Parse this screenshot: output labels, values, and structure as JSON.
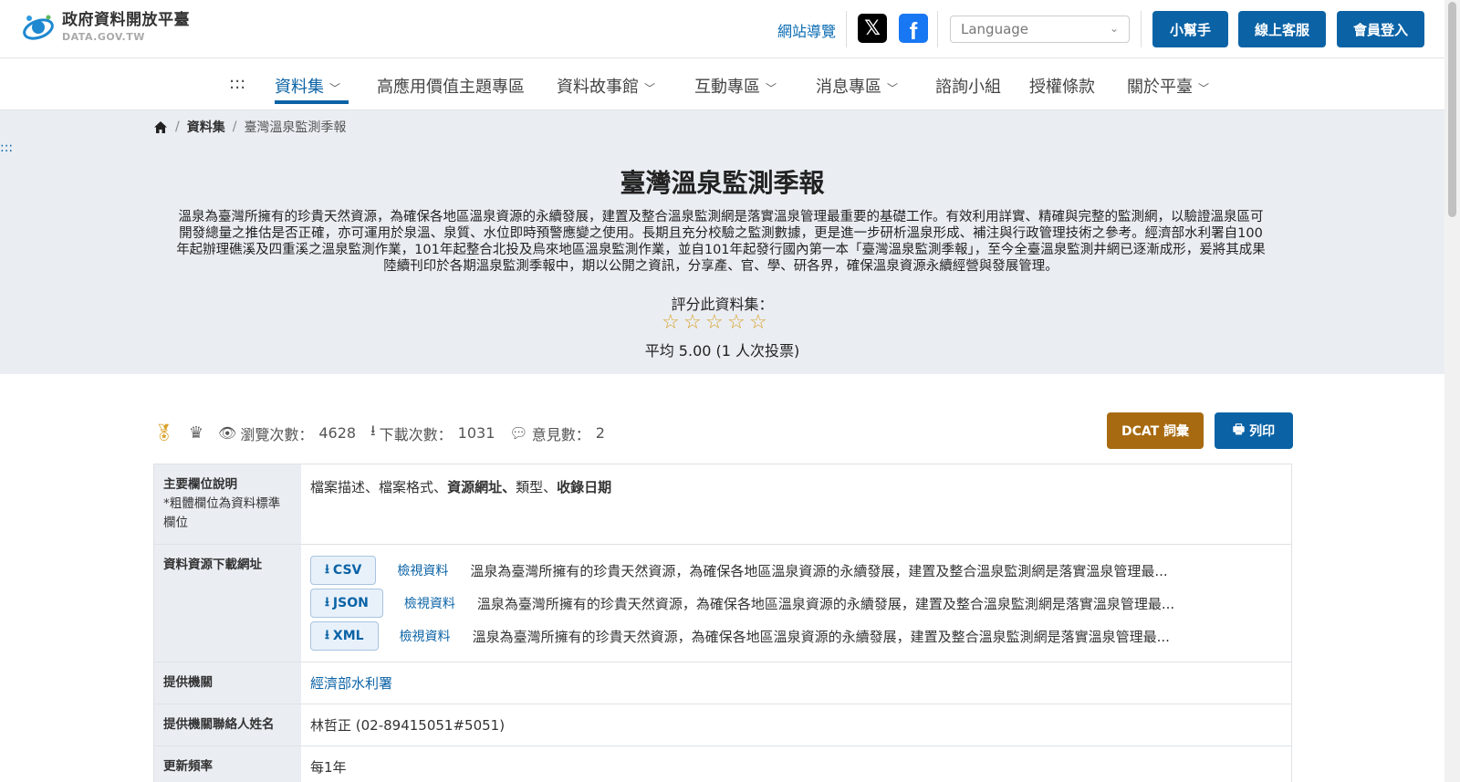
{
  "header": {
    "logo_title": "政府資料開放平臺",
    "logo_sub": "DATA.GOV.TW",
    "sitemap": "網站導覽",
    "language_placeholder": "Language",
    "buttons": [
      "小幫手",
      "線上客服",
      "會員登入"
    ]
  },
  "nav": {
    "accesskey": ":::",
    "items": [
      {
        "label": "資料集",
        "dropdown": true,
        "active": true
      },
      {
        "label": "高應用價值主題專區",
        "dropdown": false
      },
      {
        "label": "資料故事館",
        "dropdown": true
      },
      {
        "label": "互動專區",
        "dropdown": true
      },
      {
        "label": "消息專區",
        "dropdown": true
      },
      {
        "label": "諮詢小組",
        "dropdown": false
      },
      {
        "label": "授權條款",
        "dropdown": false
      },
      {
        "label": "關於平臺",
        "dropdown": true
      }
    ]
  },
  "breadcrumb": {
    "home_icon": "home-icon",
    "level1": "資料集",
    "current": "臺灣溫泉監測季報"
  },
  "hero": {
    "accesskey": ":::",
    "title": "臺灣溫泉監測季報",
    "description": "溫泉為臺灣所擁有的珍貴天然資源，為確保各地區溫泉資源的永續發展，建置及整合溫泉監測網是落實溫泉管理最重要的基礎工作。有效利用詳實、精確與完整的監測網，以驗證溫泉區可開發總量之推估是否正確，亦可運用於泉溫、泉質、水位即時預警應變之使用。長期且充分校驗之監測數據，更是進一步研析溫泉形成、補注與行政管理技術之參考。經濟部水利署自100年起辦理礁溪及四重溪之溫泉監測作業，101年起整合北投及烏來地區溫泉監測作業，並自101年起發行國內第一本「臺灣溫泉監測季報」，至今全臺溫泉監測井網已逐漸成形，爰將其成果陸續刊印於各期溫泉監測季報中，期以公開之資訊，分享產、官、學、研各界，確保溫泉資源永續經營與發展管理。",
    "rate_label": "評分此資料集：",
    "stars_total": 5,
    "average": "平均 5.00 (1 人次投票)"
  },
  "stats": {
    "views_label": "瀏覽次數：",
    "views": "4628",
    "downloads_label": "下載次數：",
    "downloads": "1031",
    "comments_label": "意見數：",
    "comments": "2",
    "dcat_button": "DCAT 詞彙",
    "print_button": "列印"
  },
  "table": {
    "fields_header": "主要欄位說明",
    "fields_note": "*粗體欄位為資料標準欄位",
    "fields_parts": [
      {
        "text": "檔案描述",
        "bold": false
      },
      {
        "text": "、",
        "bold": false
      },
      {
        "text": "檔案格式",
        "bold": false
      },
      {
        "text": "、",
        "bold": false
      },
      {
        "text": "資源網址",
        "bold": true
      },
      {
        "text": "、",
        "bold": true
      },
      {
        "text": "類型",
        "bold": false
      },
      {
        "text": "、",
        "bold": false
      },
      {
        "text": "收錄日期",
        "bold": true
      }
    ],
    "download_header": "資料資源下載網址",
    "resources": [
      {
        "format": "CSV",
        "view": "檢視資料",
        "desc": "溫泉為臺灣所擁有的珍貴天然資源，為確保各地區溫泉資源的永續發展，建置及整合溫泉監測網是落實溫泉管理最..."
      },
      {
        "format": "JSON",
        "view": "檢視資料",
        "desc": "溫泉為臺灣所擁有的珍貴天然資源，為確保各地區溫泉資源的永續發展，建置及整合溫泉監測網是落實溫泉管理最..."
      },
      {
        "format": "XML",
        "view": "檢視資料",
        "desc": "溫泉為臺灣所擁有的珍貴天然資源，為確保各地區溫泉資源的永續發展，建置及整合溫泉監測網是落實溫泉管理最..."
      }
    ],
    "agency_header": "提供機關",
    "agency": "經濟部水利署",
    "contact_header": "提供機關聯絡人姓名",
    "contact": "林哲正 (02-89415051#5051)",
    "frequency_header": "更新頻率",
    "frequency": "每1年"
  },
  "colors": {
    "primary": "#0b63a6",
    "dcat": "#a86a10",
    "hero_bg": "#eaeef3",
    "star": "#d9a12a"
  }
}
